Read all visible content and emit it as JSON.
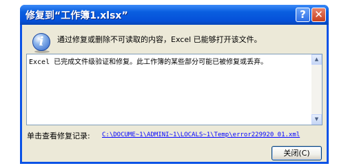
{
  "window": {
    "title": "修复到“工作簿1.xlsx”",
    "help_button": "?",
    "close_button": "✕"
  },
  "message": {
    "icon": "info-icon",
    "icon_glyph": "i",
    "text": "通过修复或删除不可读取的内容，Excel 已能够打开该文件。"
  },
  "details": {
    "text": "Excel 已完成文件级验证和修复。此工作簿的某些部分可能已被修复或丢弃。",
    "scroll_up": "▲",
    "scroll_down": "▼"
  },
  "log": {
    "label": "单击查看修复记录:",
    "link": "C:\\DOCUME~1\\ADMINI~1\\LOCALS~1\\Temp\\error229920_01.xml"
  },
  "buttons": {
    "close_label": "关闭(C)"
  }
}
